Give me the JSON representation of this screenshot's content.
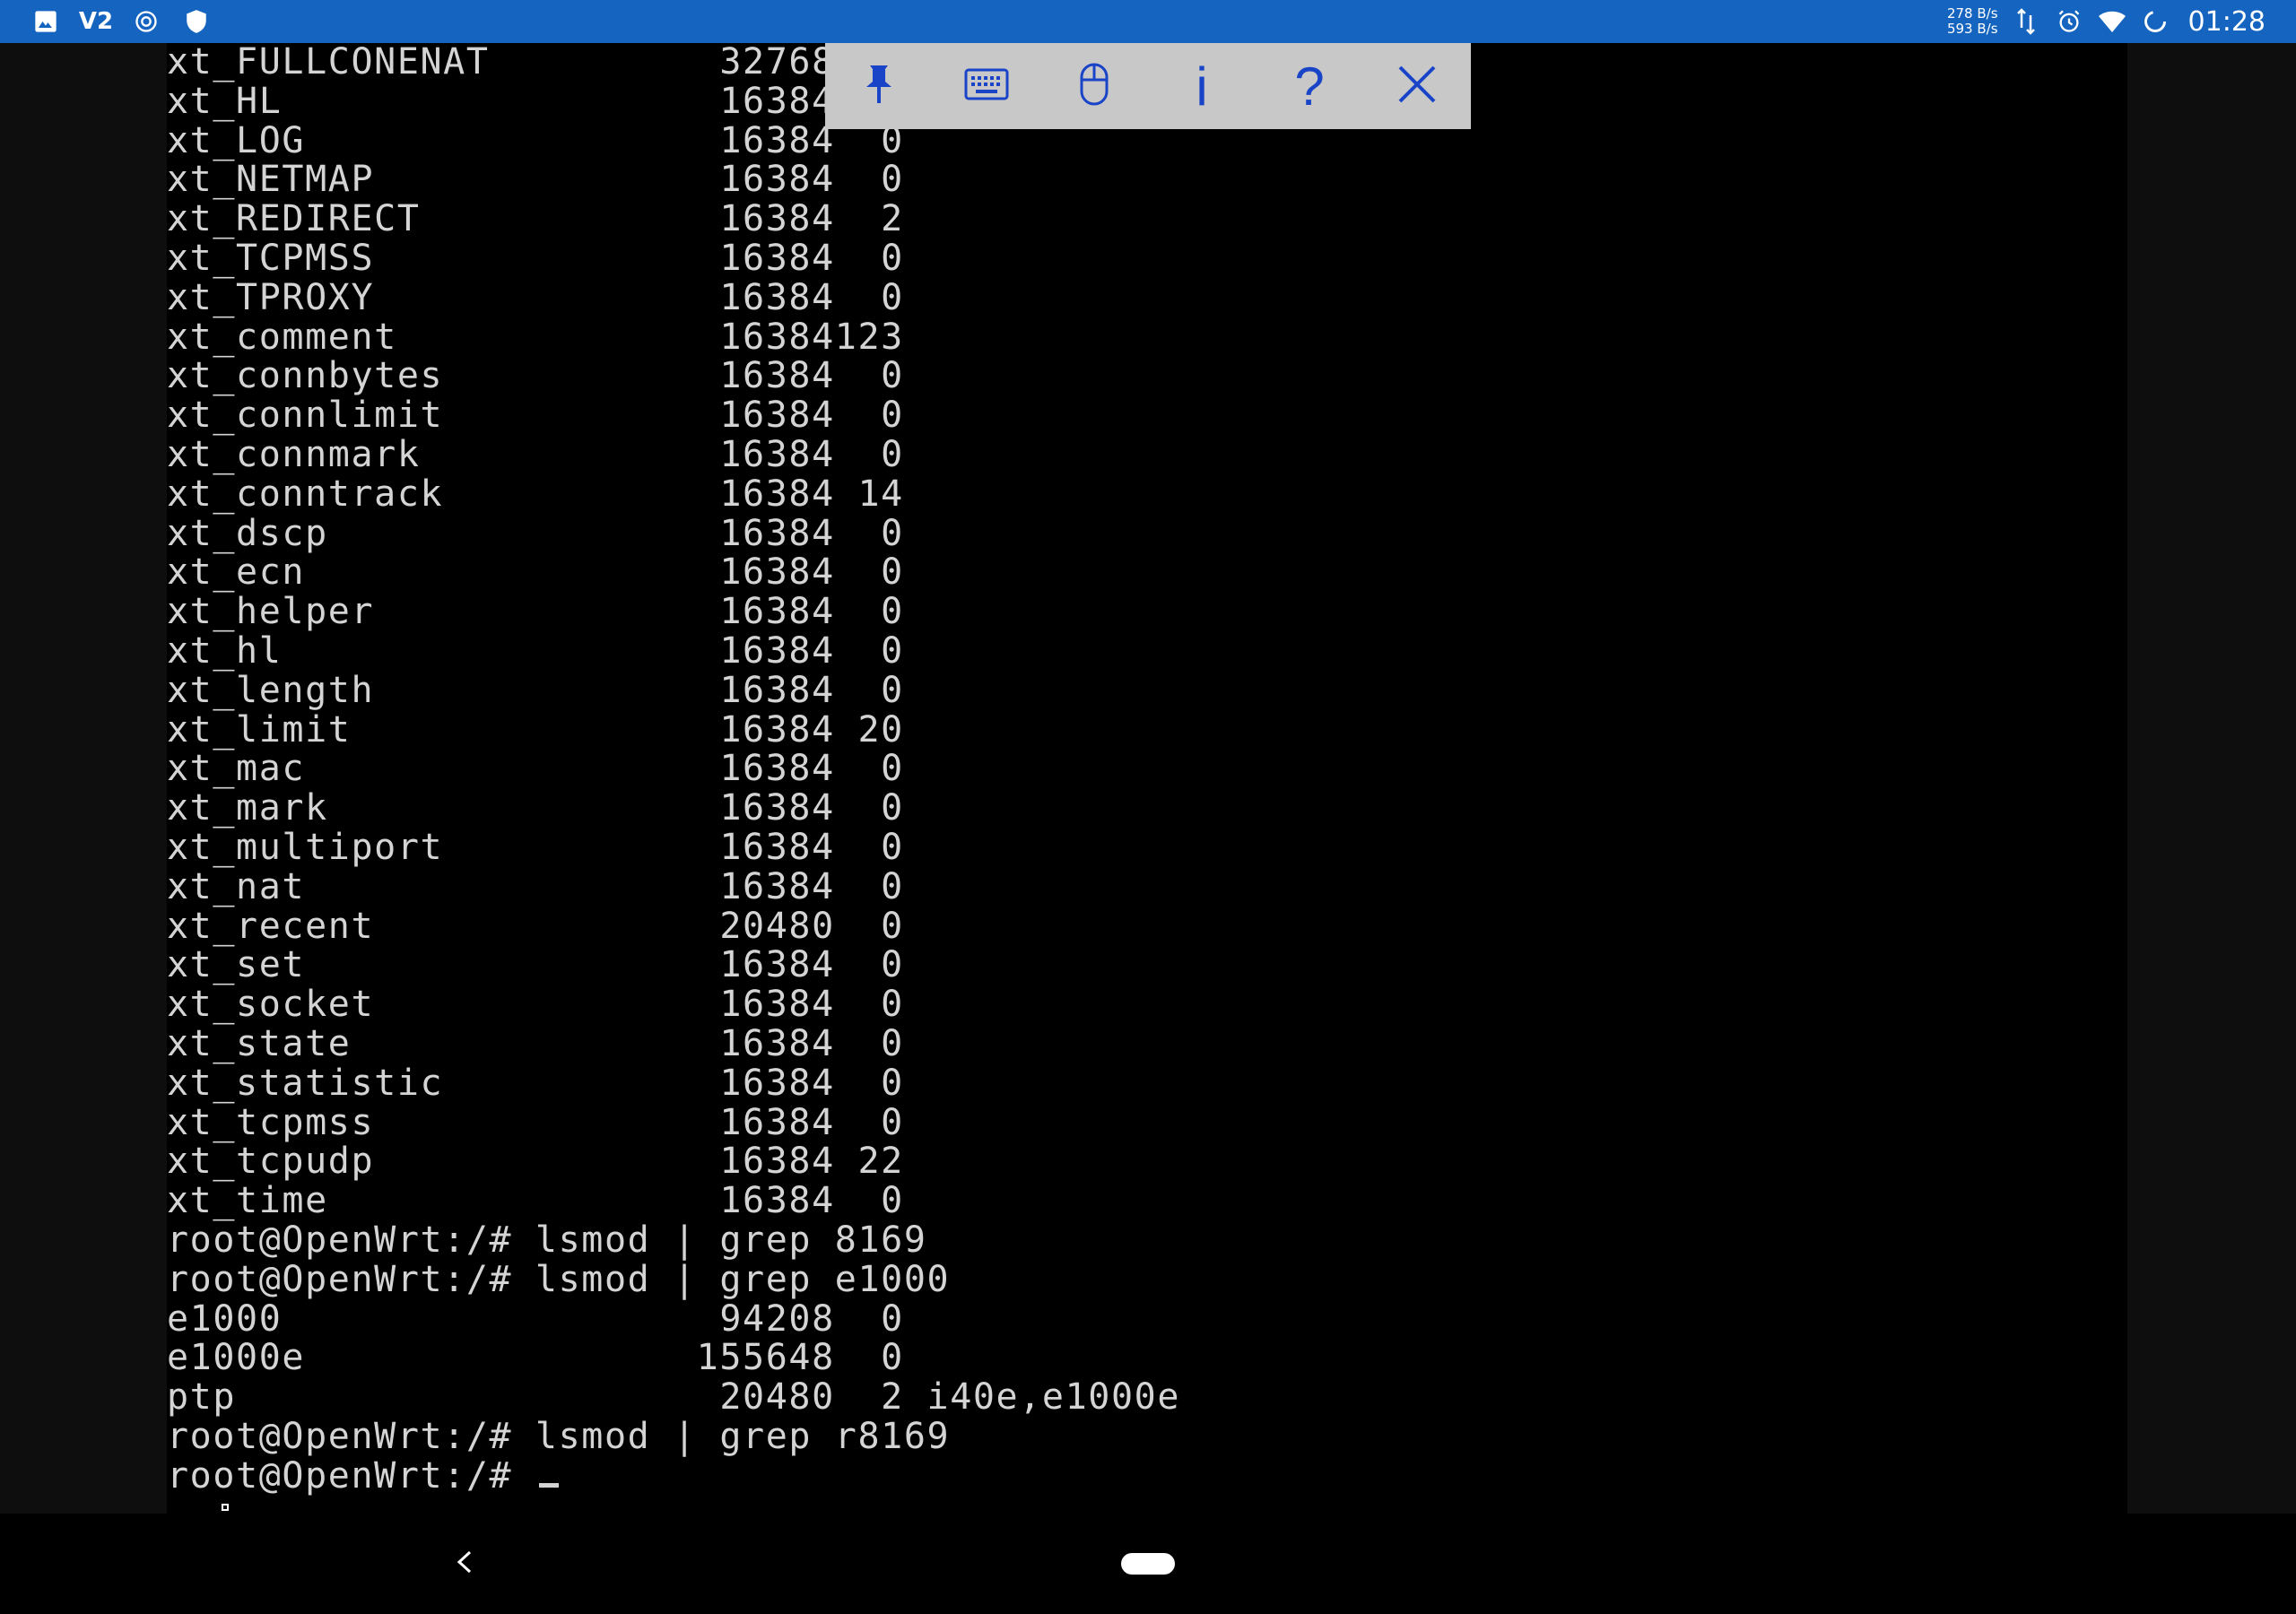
{
  "statusbar": {
    "left_icons": [
      "image-icon",
      "v2-app-icon",
      "at-sign-icon",
      "shield-icon"
    ],
    "left_text": "V2",
    "netspeed_up": "278 B/s",
    "netspeed_down": "593 B/s",
    "time": "01:28",
    "right_icons": [
      "data-transfer-icon",
      "alarm-icon",
      "wifi-icon",
      "battery-saver-icon"
    ]
  },
  "toolbar": {
    "buttons": [
      {
        "name": "pin-icon"
      },
      {
        "name": "keyboard-icon"
      },
      {
        "name": "mouse-icon"
      },
      {
        "name": "info-icon"
      },
      {
        "name": "help-icon"
      },
      {
        "name": "close-icon"
      }
    ],
    "info_label": "i",
    "help_label": "?",
    "accent_color": "#1a44c8"
  },
  "terminal": {
    "lines": [
      "xt_FULLCONENAT          32768  2",
      "xt_HL                   16384  0",
      "xt_LOG                  16384  0",
      "xt_NETMAP               16384  0",
      "xt_REDIRECT             16384  2",
      "xt_TCPMSS               16384  0",
      "xt_TPROXY               16384  0",
      "xt_comment              16384123",
      "xt_connbytes            16384  0",
      "xt_connlimit            16384  0",
      "xt_connmark             16384  0",
      "xt_conntrack            16384 14",
      "xt_dscp                 16384  0",
      "xt_ecn                  16384  0",
      "xt_helper               16384  0",
      "xt_hl                   16384  0",
      "xt_length               16384  0",
      "xt_limit                16384 20",
      "xt_mac                  16384  0",
      "xt_mark                 16384  0",
      "xt_multiport            16384  0",
      "xt_nat                  16384  0",
      "xt_recent               20480  0",
      "xt_set                  16384  0",
      "xt_socket               16384  0",
      "xt_state                16384  0",
      "xt_statistic            16384  0",
      "xt_tcpmss               16384  0",
      "xt_tcpudp               16384 22",
      "xt_time                 16384  0",
      "root@OpenWrt:/# lsmod | grep 8169",
      "root@OpenWrt:/# lsmod | grep e1000",
      "e1000                   94208  0",
      "e1000e                 155648  0",
      "ptp                     20480  2 i40e,e1000e",
      "root@OpenWrt:/# lsmod | grep r8169",
      "root@OpenWrt:/# "
    ],
    "text_color": "#d4d4d4",
    "background": "#000000"
  },
  "navbar": {
    "back_icon": "back-chevron-icon",
    "home_icon": "home-pill-icon"
  }
}
